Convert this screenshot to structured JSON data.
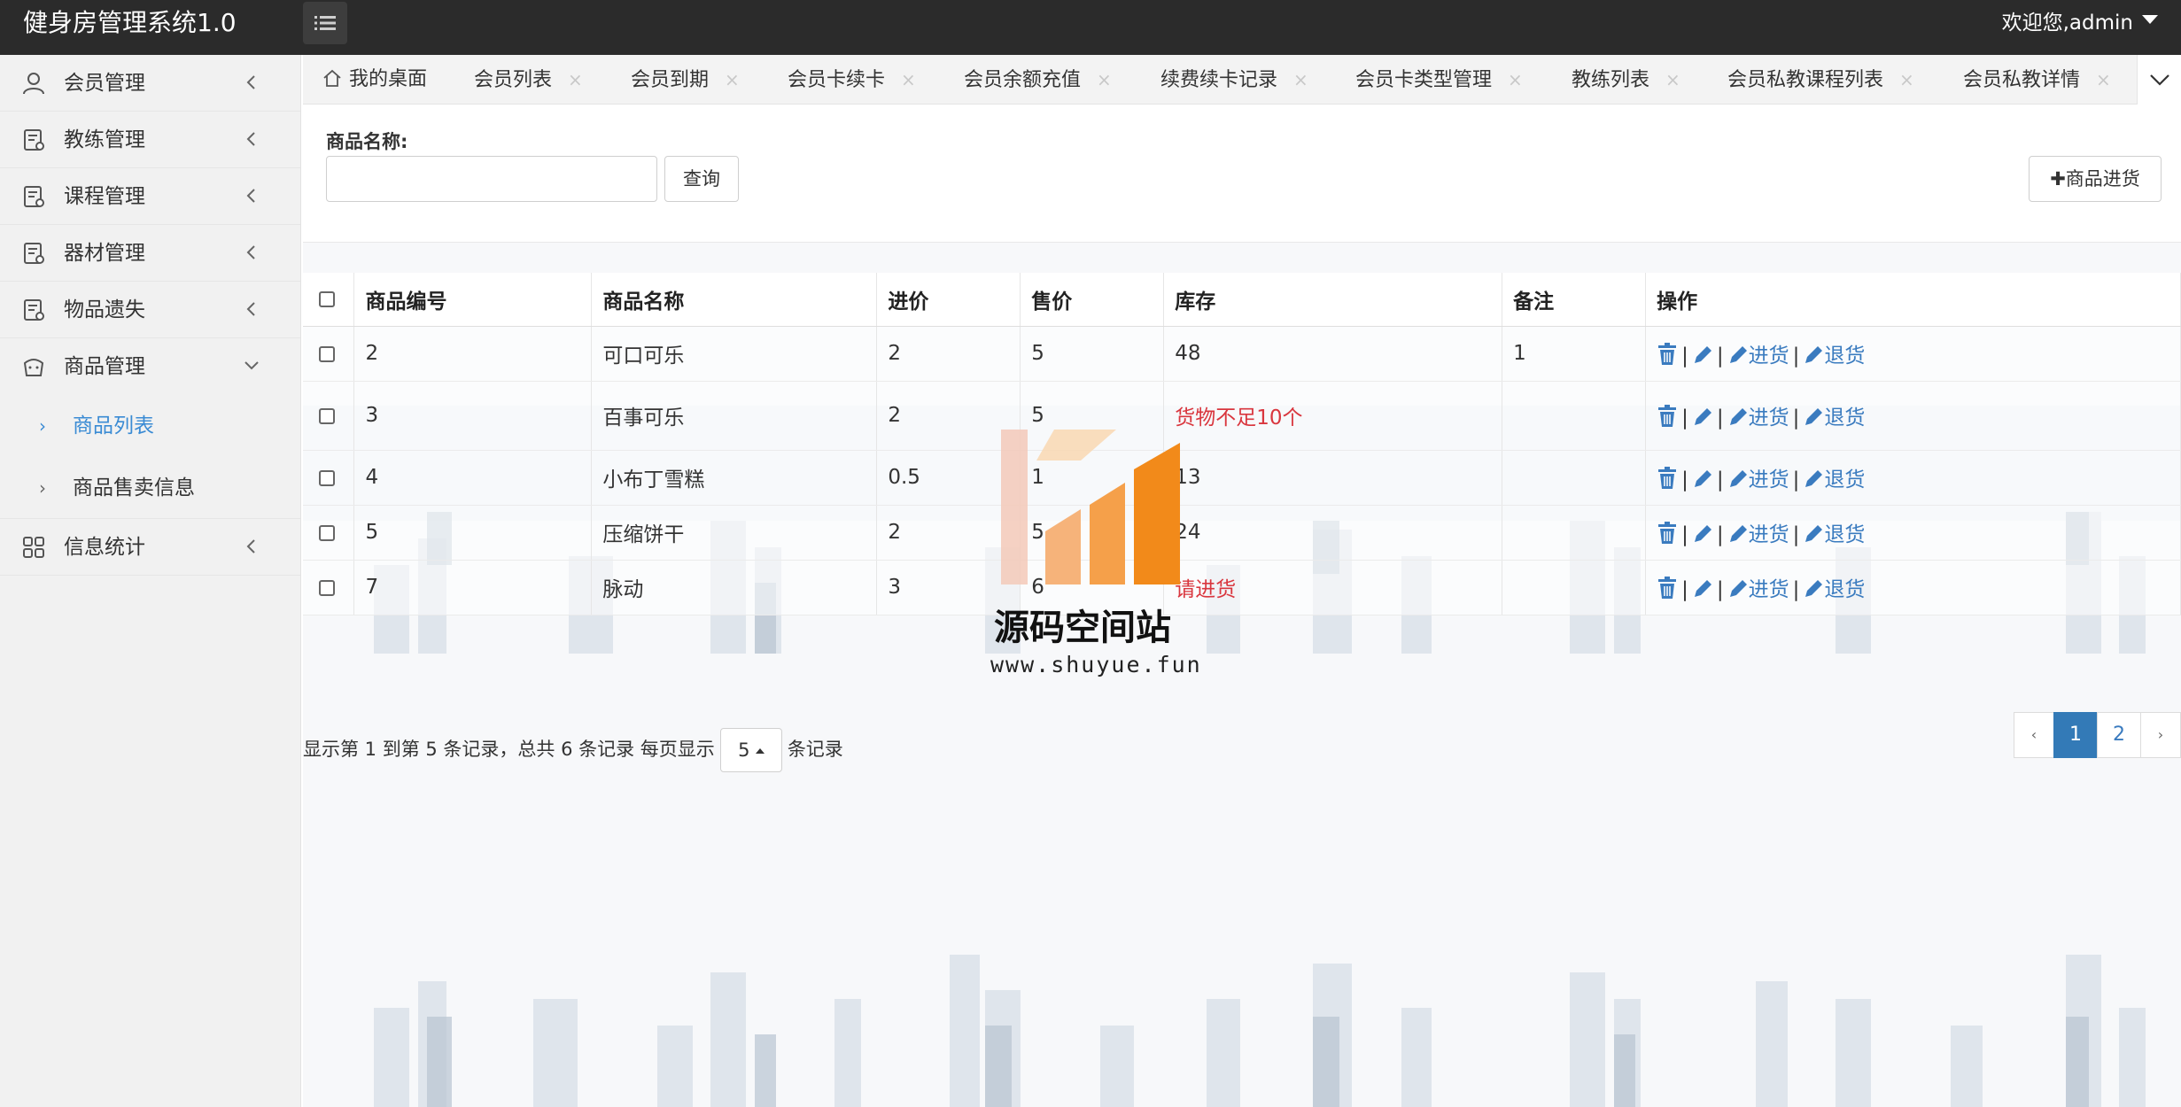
{
  "app": {
    "title": "健身房管理系统1.0",
    "user_greeting": "欢迎您,admin"
  },
  "sidebar": {
    "items": [
      {
        "label": "会员管理",
        "icon": "user-icon"
      },
      {
        "label": "教练管理",
        "icon": "document-icon"
      },
      {
        "label": "课程管理",
        "icon": "document-icon"
      },
      {
        "label": "器材管理",
        "icon": "document-icon"
      },
      {
        "label": "物品遗失",
        "icon": "document-icon"
      },
      {
        "label": "商品管理",
        "icon": "shopping-icon",
        "expanded": true
      }
    ],
    "sub_items": [
      {
        "label": "商品列表",
        "active": true
      },
      {
        "label": "商品售卖信息",
        "active": false
      }
    ],
    "last_item": {
      "label": "信息统计",
      "icon": "grid-icon"
    }
  },
  "tabs": [
    {
      "label": "我的桌面",
      "closable": false
    },
    {
      "label": "会员列表",
      "closable": true
    },
    {
      "label": "会员到期",
      "closable": true
    },
    {
      "label": "会员卡续卡",
      "closable": true
    },
    {
      "label": "会员余额充值",
      "closable": true
    },
    {
      "label": "续费续卡记录",
      "closable": true
    },
    {
      "label": "会员卡类型管理",
      "closable": true
    },
    {
      "label": "教练列表",
      "closable": true
    },
    {
      "label": "会员私教课程列表",
      "closable": true
    },
    {
      "label": "会员私教详情",
      "closable": true
    }
  ],
  "tab_close_glyph": "×",
  "search": {
    "label": "商品名称:",
    "value": "",
    "placeholder": "",
    "query_button": "查询",
    "add_button": "✚商品进货"
  },
  "table": {
    "columns": [
      "商品编号",
      "商品名称",
      "进价",
      "售价",
      "库存",
      "备注",
      "操作"
    ],
    "rows": [
      {
        "id": "2",
        "name": "可口可乐",
        "cost": "2",
        "price": "5",
        "stock": "48",
        "stock_warn": false,
        "note": "1"
      },
      {
        "id": "3",
        "name": "百事可乐",
        "cost": "2",
        "price": "5",
        "stock": "货物不足10个",
        "stock_warn": true,
        "note": ""
      },
      {
        "id": "4",
        "name": "小布丁雪糕",
        "cost": "0.5",
        "price": "1",
        "stock": "13",
        "stock_warn": false,
        "note": ""
      },
      {
        "id": "5",
        "name": "压缩饼干",
        "cost": "2",
        "price": "5",
        "stock": "24",
        "stock_warn": false,
        "note": ""
      },
      {
        "id": "7",
        "name": "脉动",
        "cost": "3",
        "price": "6",
        "stock": "请进货",
        "stock_warn": true,
        "note": ""
      }
    ],
    "actions": {
      "restock": "进货",
      "return": "退货",
      "separator": "|"
    }
  },
  "pagination": {
    "info_prefix": "显示第 1 到第 5 条记录，总共 6 条记录 每页显示",
    "page_size": "5",
    "info_suffix": "条记录",
    "prev": "‹",
    "pages": [
      "1",
      "2"
    ],
    "current_page": "1",
    "next": "›"
  },
  "watermark": {
    "title": "源码空间站",
    "url": "www.shuyue.fun"
  },
  "colors": {
    "topbar": "#2b2b2b",
    "sidebar": "#f1f1f1",
    "accent": "#3a8bd4",
    "warning": "#d9363e",
    "pager_active": "#337ab7",
    "logo_orange": "#f28a1a"
  }
}
